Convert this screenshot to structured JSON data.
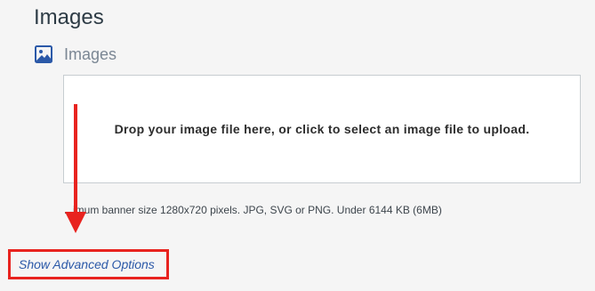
{
  "section": {
    "title": "Images"
  },
  "field": {
    "label": "Images",
    "icon": "image-icon"
  },
  "dropzone": {
    "text": "Drop your image file here, or click to select an image file to upload."
  },
  "hint": {
    "text": "...imum banner size 1280x720 pixels. JPG, SVG or PNG. Under 6144 KB (6MB)"
  },
  "advanced": {
    "label": "Show Advanced Options"
  },
  "colors": {
    "annotation": "#e8231f",
    "link": "#2b59a8",
    "icon": "#2b59a8"
  }
}
